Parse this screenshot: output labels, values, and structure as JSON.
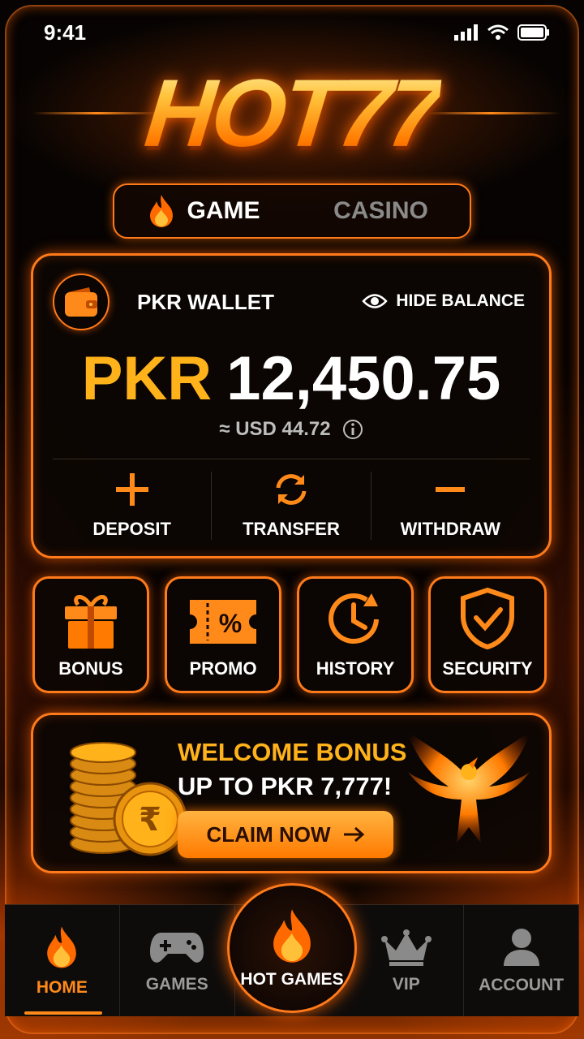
{
  "status": {
    "time": "9:41"
  },
  "logo": {
    "text": "HOT77"
  },
  "tabs": [
    {
      "label": "GAME",
      "active": true
    },
    {
      "label": "CASINO",
      "active": false
    }
  ],
  "wallet": {
    "title": "PKR WALLET",
    "hide_label": "HIDE BALANCE",
    "currency": "PKR",
    "amount": "12,450.75",
    "usd_equiv": "≈ USD 44.72",
    "actions": [
      {
        "label": "DEPOSIT",
        "icon": "plus-icon"
      },
      {
        "label": "TRANSFER",
        "icon": "refresh-icon"
      },
      {
        "label": "WITHDRAW",
        "icon": "minus-icon"
      }
    ]
  },
  "quick": [
    {
      "label": "BONUS",
      "icon": "gift-icon"
    },
    {
      "label": "PROMO",
      "icon": "ticket-icon"
    },
    {
      "label": "HISTORY",
      "icon": "clock-icon"
    },
    {
      "label": "SECURITY",
      "icon": "shield-icon"
    }
  ],
  "banner": {
    "line1": "WELCOME BONUS",
    "line2": "UP TO PKR 7,777!",
    "cta": "CLAIM NOW",
    "coin_symbol": "₹"
  },
  "nav": [
    {
      "label": "HOME",
      "icon": "flame-icon",
      "active": true
    },
    {
      "label": "GAMES",
      "icon": "gamepad-icon"
    },
    {
      "label": "HOT GAMES",
      "icon": "flame-icon"
    },
    {
      "label": "VIP",
      "icon": "crown-icon"
    },
    {
      "label": "ACCOUNT",
      "icon": "user-icon"
    }
  ],
  "colors": {
    "accent": "#ff7a1a",
    "gold": "#ffb21a",
    "bg": "#060302"
  }
}
